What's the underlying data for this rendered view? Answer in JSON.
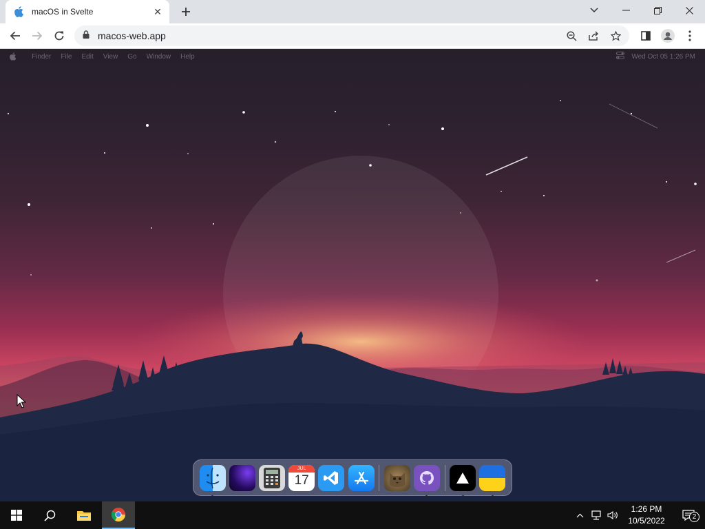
{
  "browser": {
    "tab_title": "macOS in Svelte",
    "url": "macos-web.app"
  },
  "macos": {
    "menubar": {
      "items": [
        "Finder",
        "File",
        "Edit",
        "View",
        "Go",
        "Window",
        "Help"
      ],
      "datetime": "Wed Oct 05  1:26 PM"
    },
    "dock": {
      "apps": [
        {
          "name": "finder-app",
          "running": true
        },
        {
          "name": "wallpapers-app",
          "running": false
        },
        {
          "name": "calculator-app",
          "running": false
        },
        {
          "name": "calendar-app",
          "running": false,
          "month": "JUL",
          "day": "17"
        },
        {
          "name": "vscode-app",
          "running": false
        },
        {
          "name": "app-store-app",
          "running": false
        },
        {
          "name": "purrfect-cat-app",
          "running": false
        },
        {
          "name": "github-app",
          "running": true
        },
        {
          "name": "vercel-app",
          "running": true
        },
        {
          "name": "ukraine-app",
          "running": true
        }
      ]
    }
  },
  "taskbar": {
    "time": "1:26 PM",
    "date": "10/5/2022",
    "notification_count": "2"
  }
}
